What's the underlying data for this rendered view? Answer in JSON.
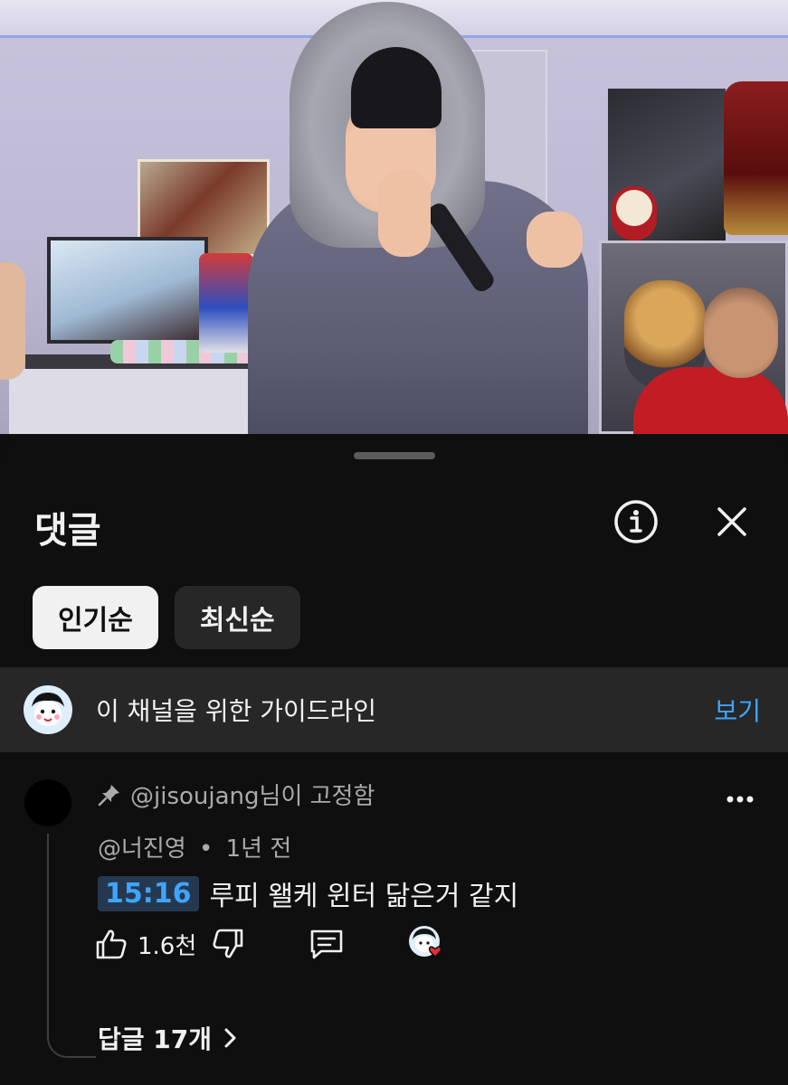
{
  "video": {
    "description_hidden": ""
  },
  "sheet": {
    "title": "댓글",
    "info_icon": "info-circle-icon",
    "close_icon": "close-icon"
  },
  "sort": {
    "options": [
      {
        "label": "인기순",
        "active": true
      },
      {
        "label": "최신순",
        "active": false
      }
    ]
  },
  "guideline": {
    "text": "이 채널을 위한 가이드라인",
    "link": "보기"
  },
  "comment": {
    "pinned_by": "@jisoujang님이 고정함",
    "author": "@너진영",
    "separator": "•",
    "time": "1년 전",
    "timestamp": "15:16",
    "text": "루피 왤케 윈터 닮은거 같지",
    "like_count": "1.6천",
    "replies_label": "답글 17개"
  },
  "colors": {
    "background": "#0f0f0f",
    "surface": "#272727",
    "text": "#f1f1f1",
    "secondary_text": "#aaaaaa",
    "link": "#3ea6ff",
    "heart": "#e52c3a"
  }
}
